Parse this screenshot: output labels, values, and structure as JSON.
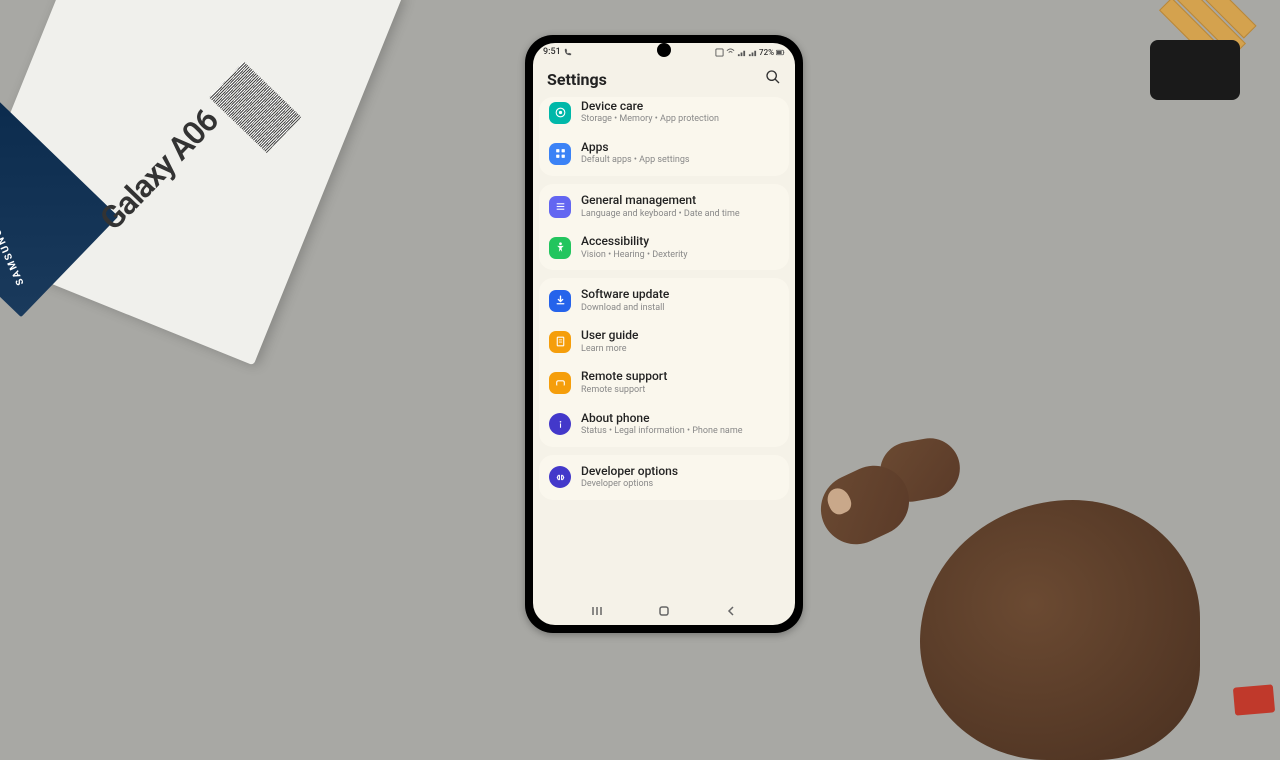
{
  "status": {
    "time": "9:51",
    "battery": "72%"
  },
  "header": {
    "title": "Settings"
  },
  "box": {
    "model": "Galaxy A06",
    "brand": "SAMSUNG"
  },
  "items": {
    "device_care": {
      "title": "Device care",
      "subtitle": "Storage  •  Memory  •  App protection"
    },
    "apps": {
      "title": "Apps",
      "subtitle": "Default apps  •  App settings"
    },
    "general": {
      "title": "General management",
      "subtitle": "Language and keyboard  •  Date and time"
    },
    "accessibility": {
      "title": "Accessibility",
      "subtitle": "Vision  •  Hearing  •  Dexterity"
    },
    "software": {
      "title": "Software update",
      "subtitle": "Download and install"
    },
    "guide": {
      "title": "User guide",
      "subtitle": "Learn more"
    },
    "remote": {
      "title": "Remote support",
      "subtitle": "Remote support"
    },
    "about": {
      "title": "About phone",
      "subtitle": "Status  •  Legal information  •  Phone name"
    },
    "developer": {
      "title": "Developer options",
      "subtitle": "Developer options"
    }
  }
}
